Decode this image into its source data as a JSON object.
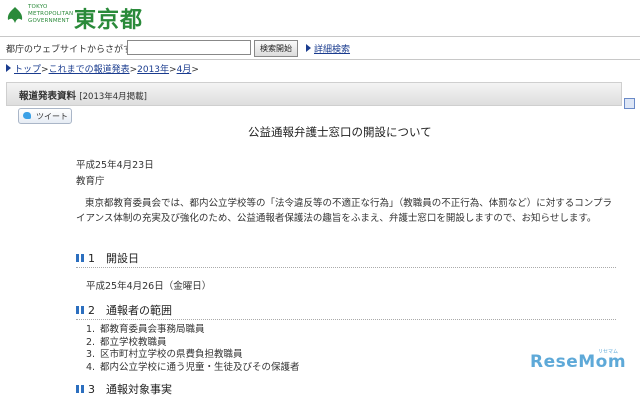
{
  "header": {
    "logo_small_lines": [
      "TOKYO",
      "METROPOLITAN",
      "GOVERNMENT"
    ],
    "logo_name": "東京都"
  },
  "search": {
    "label": "都庁のウェブサイトからさがす",
    "input_value": "",
    "button_label": "検索開始",
    "advanced_label": "詳細検索"
  },
  "breadcrumb": {
    "items": [
      "トップ",
      "これまでの報道発表",
      "2013年",
      "4月"
    ],
    "separator": ">"
  },
  "band": {
    "title": "報道発表資料",
    "date_note": "[2013年4月掲載]"
  },
  "tweet_label": "ツイート",
  "article": {
    "title": "公益通報弁護士窓口の開設について",
    "date": "平成25年4月23日",
    "org": "教育庁",
    "body": "東京都教育委員会では、都内公立学校等の「法令違反等の不適正な行為」（教職員の不正行為、体罰など）に対するコンプライアンス体制の充実及び強化のため、公益通報者保護法の趣旨をふまえ、弁護士窓口を開設しますので、お知らせします。",
    "sections": [
      {
        "heading": "1　開設日",
        "content": "平成25年4月26日（金曜日）"
      },
      {
        "heading": "2　通報者の範囲",
        "items": [
          "都教育委員会事務局職員",
          "都立学校教職員",
          "区市町村立学校の県費負担教職員",
          "都内公立学校に通う児童・生徒及びその保護者"
        ]
      },
      {
        "heading": "3　通報対象事実"
      }
    ]
  },
  "watermark": {
    "text": "ReseMom",
    "small": "リセマム"
  }
}
